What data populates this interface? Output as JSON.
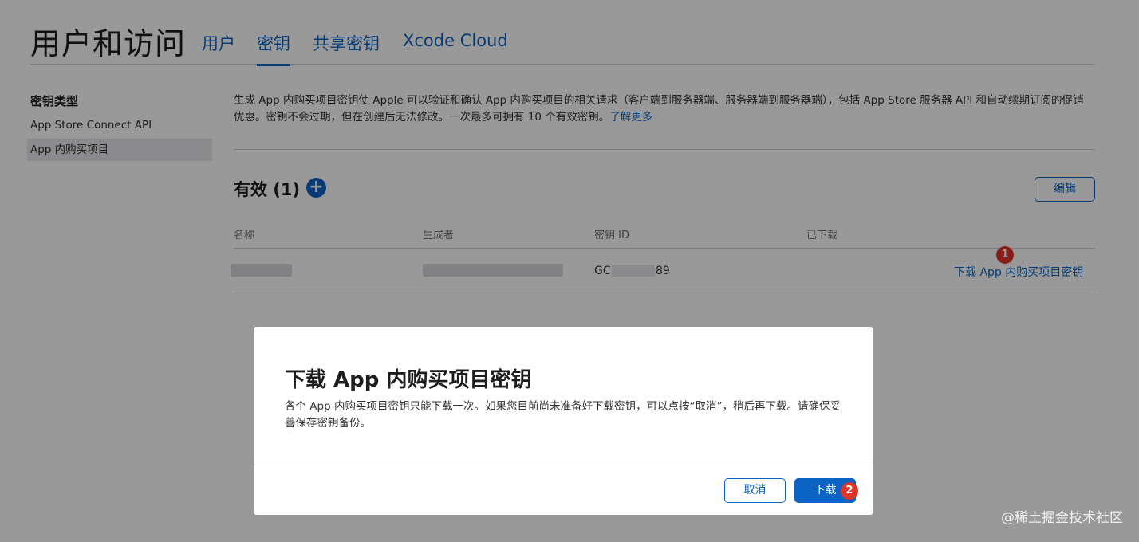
{
  "header": {
    "title": "用户和访问",
    "tabs": [
      {
        "label": "用户",
        "active": false
      },
      {
        "label": "密钥",
        "active": true
      },
      {
        "label": "共享密钥",
        "active": false
      },
      {
        "label": "Xcode Cloud",
        "active": false
      }
    ]
  },
  "sidebar": {
    "heading": "密钥类型",
    "items": [
      {
        "label": "App Store Connect API",
        "selected": false
      },
      {
        "label": "App 内购买项目",
        "selected": true
      }
    ]
  },
  "main": {
    "description": "生成 App 内购买项目密钥使 Apple 可以验证和确认 App 内购买项目的相关请求（客户端到服务器端、服务器端到服务器端），包括 App Store 服务器 API 和自动续期订阅的促销优惠。密钥不会过期，但在创建后无法修改。一次最多可拥有 10 个有效密钥。",
    "learn_more": "了解更多",
    "section_title": "有效 (1)",
    "add_icon": "plus-circle-icon",
    "edit_label": "编辑",
    "table": {
      "headers": [
        "名称",
        "生成者",
        "密钥 ID",
        "已下载"
      ],
      "rows": [
        {
          "name": "",
          "created_by": "",
          "key_id_prefix": "GC",
          "key_id_suffix": "89",
          "downloaded": "",
          "action": "下载 App 内购买项目密钥"
        }
      ]
    }
  },
  "annotations": {
    "step1": "1",
    "step2": "2"
  },
  "dialog": {
    "title": "下载 App 内购买项目密钥",
    "body": "各个 App 内购买项目密钥只能下载一次。如果您目前尚未准备好下载密钥，可以点按“取消”，稍后再下载。请确保妥善保存密钥备份。",
    "cancel_label": "取消",
    "download_label": "下载"
  },
  "watermark": "@稀土掘金技术社区",
  "colors": {
    "accent": "#0b63c4",
    "badge": "#e0332a",
    "overlay": "rgba(0,0,0,0.40)"
  }
}
